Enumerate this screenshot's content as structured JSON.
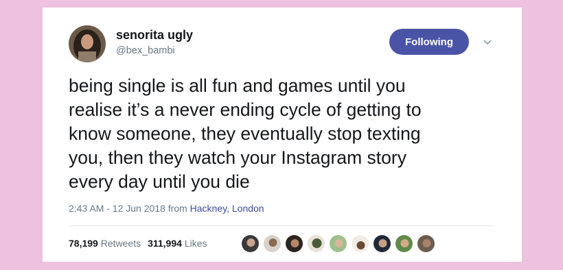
{
  "tweet": {
    "display_name": "senorita ugly",
    "handle": "@bex_bambi",
    "follow_label": "Following",
    "text": "being single is all fun and games until you\nrealise it’s a never ending cycle of getting to\nknow someone, they eventually stop texting\nyou, then they watch your Instagram story\nevery day until you die",
    "time": "2:43 AM - 12 Jun 2018 from",
    "location": "Hackney, London",
    "retweets_count": "78,199",
    "retweets_label": "Retweets",
    "likes_count": "311,994",
    "likes_label": "Likes"
  },
  "icons": {
    "more": "chevron-down-icon"
  },
  "colors": {
    "background": "#eec1de",
    "button": "#4a54a6",
    "link": "#3b4a9c"
  }
}
